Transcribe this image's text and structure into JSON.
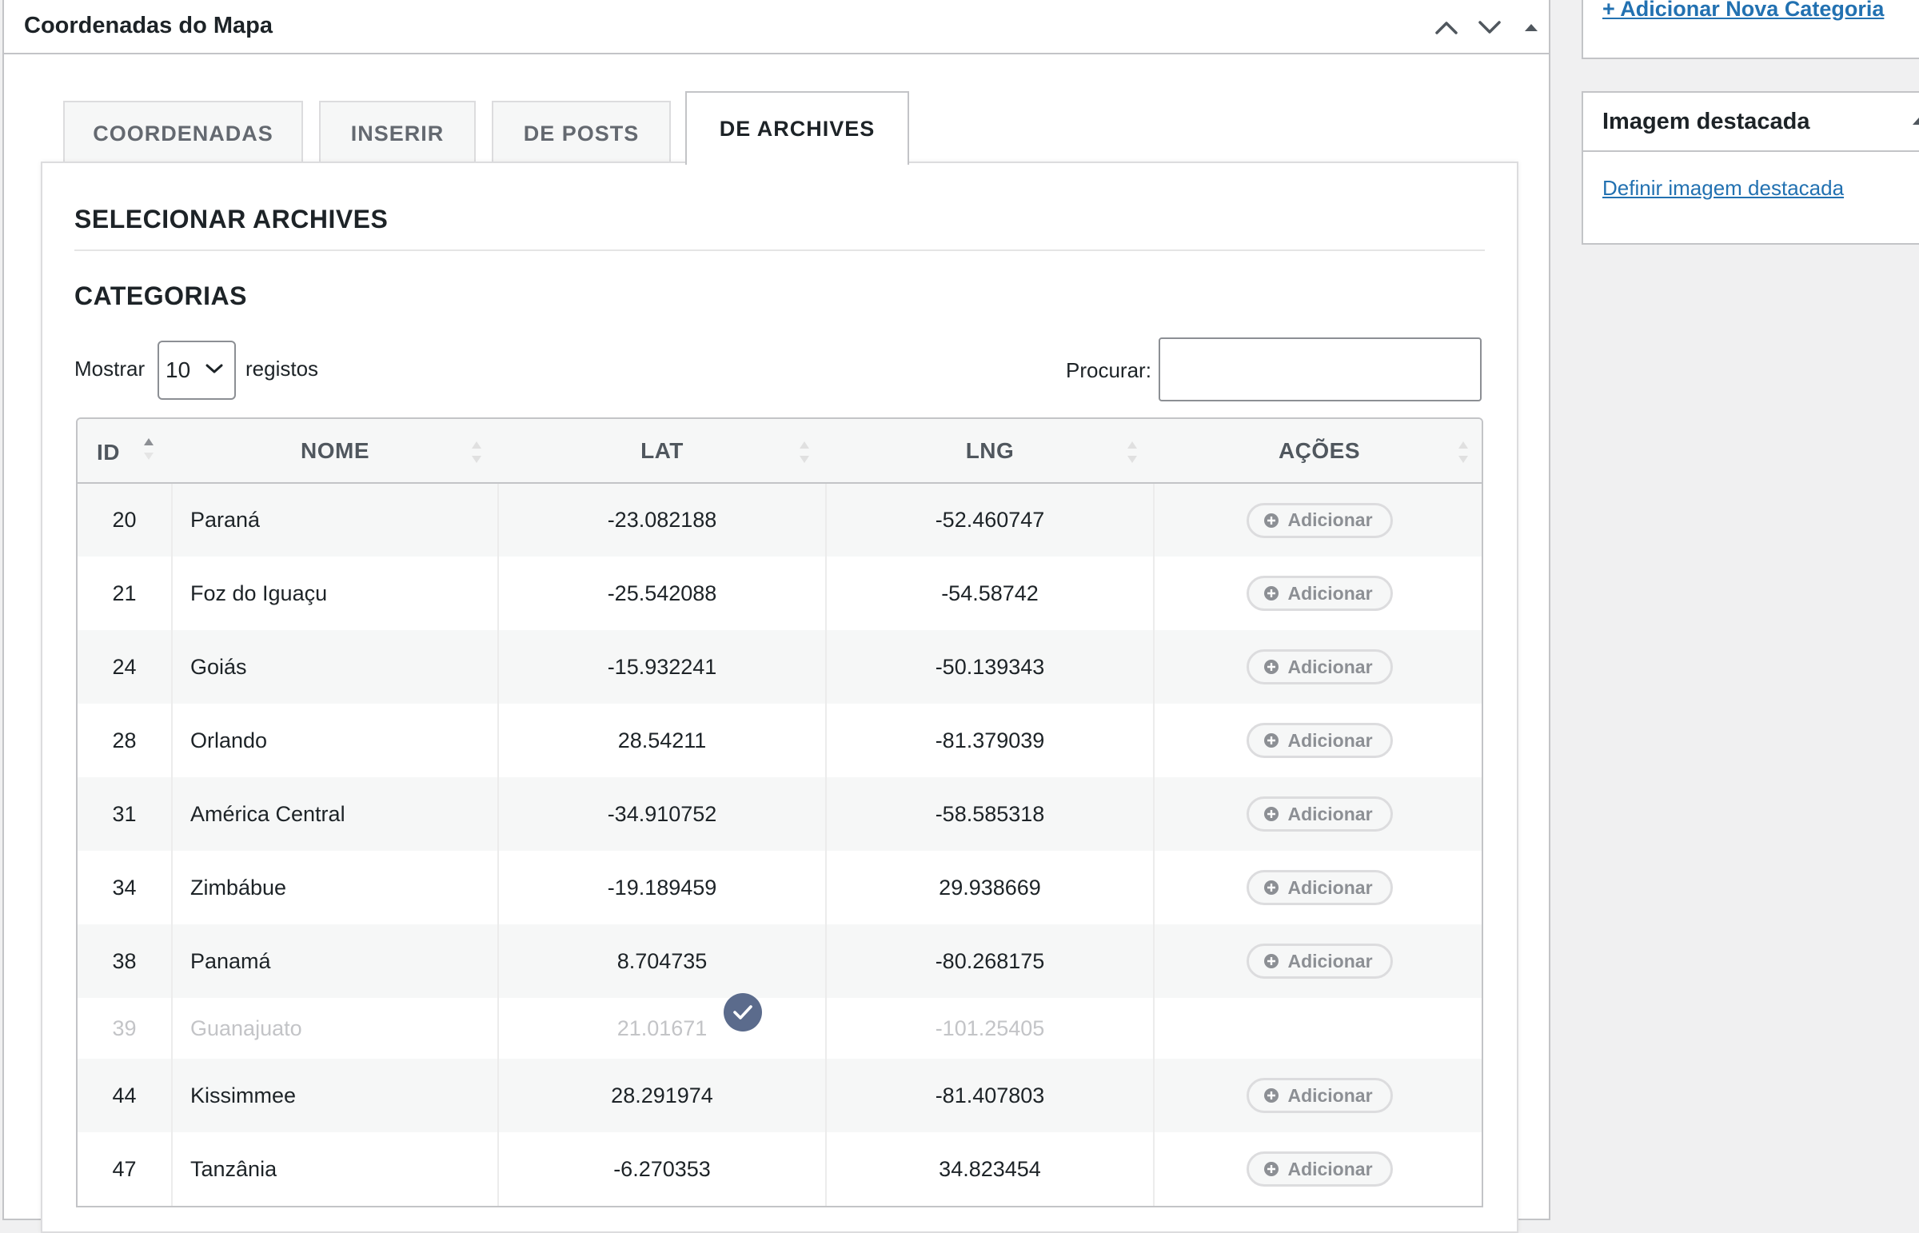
{
  "metabox": {
    "title": "Coordenadas do Mapa",
    "tabs": [
      {
        "label": "COORDENADAS",
        "active": false
      },
      {
        "label": "INSERIR",
        "active": false
      },
      {
        "label": "DE POSTS",
        "active": false
      },
      {
        "label": "DE ARCHIVES",
        "active": true
      }
    ],
    "panel_title": "SELECIONAR ARCHIVES",
    "section_title": "CATEGORIAS",
    "length": {
      "prefix": "Mostrar",
      "value": "10",
      "suffix": "registos"
    },
    "search": {
      "label": "Procurar:",
      "value": ""
    },
    "table": {
      "headers": {
        "id": "ID",
        "name": "NOME",
        "lat": "LAT",
        "lng": "LNG",
        "actions": "AÇÕES"
      },
      "action_label": "Adicionar",
      "rows": [
        {
          "id": "20",
          "name": "Paraná",
          "lat": "-23.082188",
          "lng": "-52.460747",
          "added": false
        },
        {
          "id": "21",
          "name": "Foz do Iguaçu",
          "lat": "-25.542088",
          "lng": "-54.58742",
          "added": false
        },
        {
          "id": "24",
          "name": "Goiás",
          "lat": "-15.932241",
          "lng": "-50.139343",
          "added": false
        },
        {
          "id": "28",
          "name": "Orlando",
          "lat": "28.54211",
          "lng": "-81.379039",
          "added": false
        },
        {
          "id": "31",
          "name": "América Central",
          "lat": "-34.910752",
          "lng": "-58.585318",
          "added": false
        },
        {
          "id": "34",
          "name": "Zimbábue",
          "lat": "-19.189459",
          "lng": "29.938669",
          "added": false
        },
        {
          "id": "38",
          "name": "Panamá",
          "lat": "8.704735",
          "lng": "-80.268175",
          "added": false
        },
        {
          "id": "39",
          "name": "Guanajuato",
          "lat": "21.01671",
          "lng": "-101.25405",
          "added": true
        },
        {
          "id": "44",
          "name": "Kissimmee",
          "lat": "28.291974",
          "lng": "-81.407803",
          "added": false
        },
        {
          "id": "47",
          "name": "Tanzânia",
          "lat": "-6.270353",
          "lng": "34.823454",
          "added": false
        }
      ]
    }
  },
  "sidebar": {
    "add_category_link": "+ Adicionar Nova Categoria",
    "featured_image": {
      "title": "Imagem destacada",
      "link": "Definir imagem destacada"
    }
  },
  "colors": {
    "link": "#2271b1",
    "check_badge": "#5b6b8c",
    "border": "#c3c4c7"
  }
}
